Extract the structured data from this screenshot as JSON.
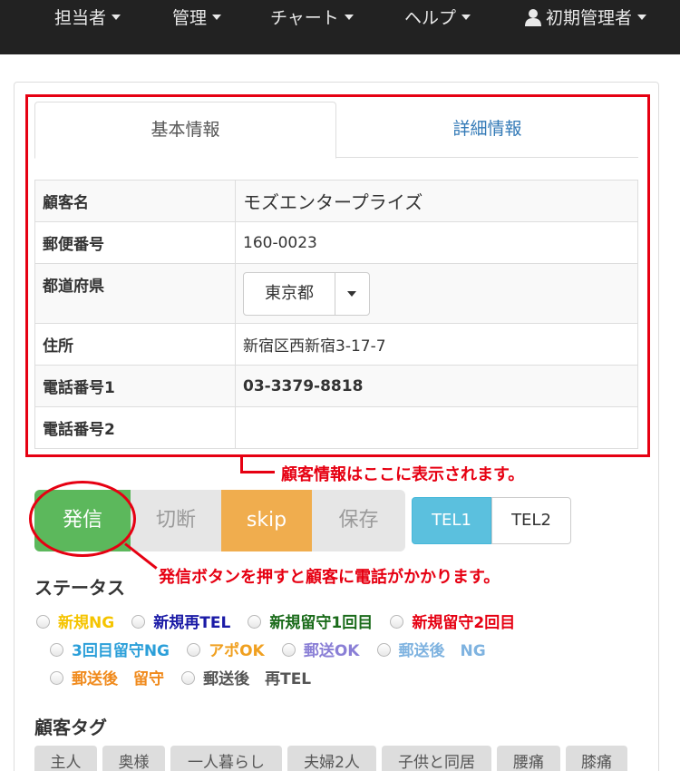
{
  "navbar": {
    "items": [
      "担当者",
      "管理",
      "チャート",
      "ヘルプ"
    ],
    "user": "初期管理者"
  },
  "tabs": {
    "basic": "基本情報",
    "detail": "詳細情報"
  },
  "customer": {
    "rows": [
      {
        "label": "顧客名",
        "value": "モズエンタープライズ"
      },
      {
        "label": "郵便番号",
        "value": "160-0023"
      },
      {
        "label": "都道府県",
        "value": "東京都"
      },
      {
        "label": "住所",
        "value": "新宿区西新宿3-17-7"
      },
      {
        "label": "電話番号1",
        "value": "03-3379-8818"
      },
      {
        "label": "電話番号2",
        "value": ""
      }
    ]
  },
  "callouts": {
    "info": "顧客情報はここに表示されます。",
    "call": "発信ボタンを押すと顧客に電話がかかります。"
  },
  "actions": {
    "call": "発信",
    "hangup": "切断",
    "skip": "skip",
    "save": "保存",
    "tel1": "TEL1",
    "tel2": "TEL2"
  },
  "status": {
    "title": "ステータス",
    "options": [
      {
        "label": "新規NG",
        "color": "#f5c400"
      },
      {
        "label": "新規再TEL",
        "color": "#1a1aa6"
      },
      {
        "label": "新規留守1回目",
        "color": "#1a6b1a"
      },
      {
        "label": "新規留守2回目",
        "color": "#e60012"
      },
      {
        "label": "3回目留守NG",
        "color": "#2b9fd9"
      },
      {
        "label": "アポOK",
        "color": "#f0a020"
      },
      {
        "label": "郵送OK",
        "color": "#8a7fd6"
      },
      {
        "label": "郵送後　NG",
        "color": "#7fb3e0"
      },
      {
        "label": "郵送後　留守",
        "color": "#f08a1c"
      },
      {
        "label": "郵送後　再TEL",
        "color": "#555555"
      }
    ]
  },
  "tags": {
    "title": "顧客タグ",
    "items": [
      "主人",
      "奥様",
      "一人暮らし",
      "夫婦2人",
      "子供と同居",
      "腰痛",
      "膝痛"
    ]
  }
}
